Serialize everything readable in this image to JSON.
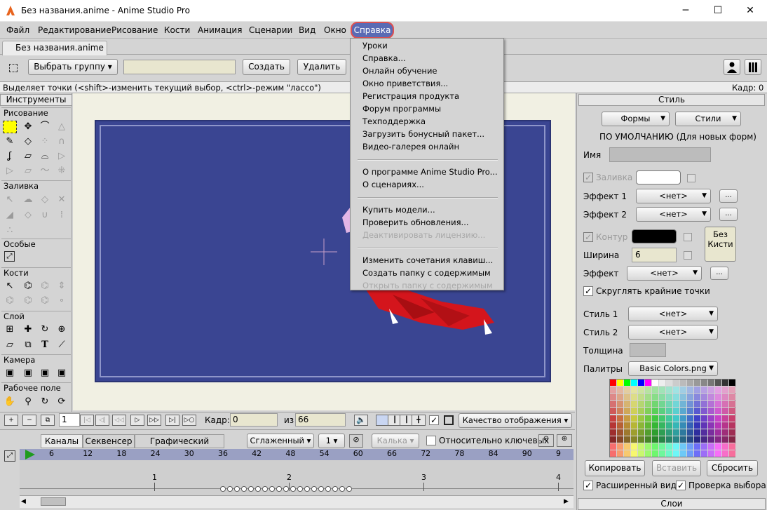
{
  "window": {
    "title": "Без названия.anime - Anime Studio Pro",
    "min": "─",
    "max": "☐",
    "close": "✕"
  },
  "menubar": [
    "Файл",
    "Редактирование",
    "Рисование",
    "Кости",
    "Анимация",
    "Сценарии",
    "Вид",
    "Окно",
    "Справка"
  ],
  "document_tab": "Без названия.anime",
  "toolbar": {
    "select_group": "Выбрать группу ▾",
    "create": "Создать",
    "delete": "Удалить"
  },
  "status": {
    "hint": "Выделяет точки (<shift>-изменить текущий выбор, <ctrl>-режим \"лассо\")",
    "frame": "Кадр: 0"
  },
  "tools": {
    "header": "Инструменты",
    "sections": [
      "Рисование",
      "Заливка",
      "Особые",
      "Кости",
      "Слой",
      "Камера",
      "Рабочее поле"
    ]
  },
  "help_menu": {
    "items": [
      {
        "label": "Уроки",
        "enabled": true
      },
      {
        "label": "Справка...",
        "enabled": true
      },
      {
        "label": "Онлайн обучение",
        "enabled": true
      },
      {
        "label": "Окно приветствия...",
        "enabled": true
      },
      {
        "label": "Регистрация продукта",
        "enabled": true
      },
      {
        "label": "Форум программы",
        "enabled": true
      },
      {
        "label": "Техподдержка",
        "enabled": true
      },
      {
        "label": "Загрузить бонусный пакет...",
        "enabled": true
      },
      {
        "label": "Видео-галерея онлайн",
        "enabled": true
      },
      {
        "label": "О программе Anime Studio Pro...",
        "enabled": true
      },
      {
        "label": "О сценариях...",
        "enabled": true
      },
      {
        "label": "Купить модели...",
        "enabled": true
      },
      {
        "label": "Проверить обновления...",
        "enabled": true
      },
      {
        "label": "Деактивировать лицензию...",
        "enabled": false
      },
      {
        "label": "Изменить сочетания клавиш...",
        "enabled": true
      },
      {
        "label": "Создать папку с содержимым",
        "enabled": true
      },
      {
        "label": "Открыть папку с содержимым",
        "enabled": false
      }
    ]
  },
  "style": {
    "title": "Стиль",
    "shapes": "Формы",
    "styles": "Стили",
    "defaults": "ПО УМОЛЧАНИЮ (Для новых форм)",
    "name_label": "Имя",
    "fill_label": "Заливка",
    "effect1": "Эффект 1",
    "effect2": "Эффект 2",
    "none": "<нет>",
    "more": "...",
    "stroke_label": "Контур",
    "width_label": "Ширина",
    "width_value": "6",
    "no_brush": "Без Кисти",
    "effect": "Эффект",
    "round_caps": "Скруглять крайние точки",
    "style1": "Стиль 1",
    "style2": "Стиль 2",
    "thickness": "Толщина",
    "palettes": "Палитры",
    "palette_value": "Basic Colors.png",
    "copy": "Копировать",
    "paste": "Вставить",
    "reset": "Сбросить",
    "expanded": "Расширенный вид",
    "check_sel": "Проверка выбора",
    "layers": "Слои",
    "fill_color": "#ffffff",
    "stroke_color": "#000000"
  },
  "timeline": {
    "frame_start": "1",
    "frame_label": "Кадр:",
    "frame_value": "0",
    "of_label": "из",
    "total": "66",
    "quality": "Качество отображения ▾",
    "tabs": [
      "Каналы",
      "Секвенсер",
      "Графический режим"
    ],
    "smooth": "Сглаженный ▾",
    "one": "1 ▾",
    "pencil": "Калька ▾",
    "relative": "Относительно ключевых",
    "ruler": [
      "6",
      "12",
      "18",
      "24",
      "30",
      "36",
      "42",
      "48",
      "54",
      "60",
      "66",
      "72",
      "78",
      "84",
      "90",
      "9"
    ],
    "beats": [
      "1",
      "2",
      "3",
      "4"
    ]
  }
}
